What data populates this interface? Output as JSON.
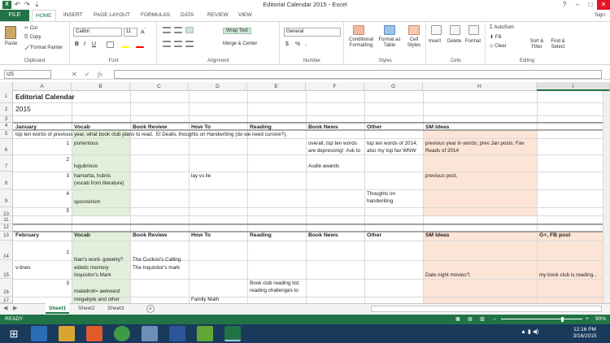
{
  "window": {
    "title": "Editorial Calendar 2015 - Excel",
    "signin": "Sign"
  },
  "quickaccess": {
    "undo": "↶",
    "redo": "↷",
    "more": "⇣"
  },
  "tabs": [
    "FILE",
    "HOME",
    "INSERT",
    "PAGE LAYOUT",
    "FORMULAS",
    "DATA",
    "REVIEW",
    "VIEW"
  ],
  "ribbon": {
    "clipboard": {
      "paste": "Paste",
      "cut": "Cut",
      "copy": "Copy",
      "painter": "Format Painter",
      "label": "Clipboard"
    },
    "font": {
      "name": "Calibri",
      "size": "11",
      "bold": "B",
      "italic": "I",
      "underline": "U",
      "label": "Font"
    },
    "alignment": {
      "wrap": "Wrap Text",
      "merge": "Merge & Center",
      "label": "Alignment"
    },
    "number": {
      "format": "General",
      "currency": "$",
      "percent": "%",
      "comma": ",",
      "label": "Number"
    },
    "styles": {
      "conditional": "Conditional Formatting",
      "table": "Format as Table",
      "cell": "Cell Styles",
      "label": "Styles"
    },
    "cells": {
      "insert": "Insert",
      "delete": "Delete",
      "format": "Format",
      "label": "Cells"
    },
    "editing": {
      "autosum": "AutoSum",
      "fill": "Fill",
      "clear": "Clear",
      "sort": "Sort & Filter",
      "find": "Find & Select",
      "label": "Editing"
    }
  },
  "formula_bar": {
    "name_box": "I25",
    "cancel": "✕",
    "enter": "✓",
    "fx": "fx",
    "value": ""
  },
  "columns": [
    "A",
    "B",
    "C",
    "D",
    "E",
    "F",
    "G",
    "H",
    "I"
  ],
  "rows": [
    "1",
    "2",
    "3",
    "4",
    "5",
    "6",
    "7",
    "8",
    "9",
    "10",
    "11",
    "12",
    "13",
    "14",
    "15",
    "16",
    "17"
  ],
  "cells": {
    "A1": "Editorial Calendar",
    "A2": "2015",
    "A4": "January",
    "B4": "Vocab",
    "C4": "Book Review",
    "D4": "How To",
    "E4": "Reading",
    "F4": "Book News",
    "G4": "Other",
    "H4": "SM Ideas",
    "A5": "top ten words of previous year, what book club plans to read,  El Deafo, thoughts on Handwriting (do we need cursive?),",
    "A6n": "1",
    "B6": "portentous",
    "F6": "overall, top ten words\nare depressing!  Ask to",
    "G6": "top ten words of 2014;\nalso my top fav WNW",
    "H6": "previous year in words; prev Jan posts; Fav\nReads of 2014",
    "A7n": "2",
    "B7": "lugubrious",
    "F7": "Audie awards",
    "A8n": "3",
    "B8": "hamartia, hubris\n(vocab from literature)",
    "D8": "lay vs lie",
    "H8": "previous post,",
    "A9n": "4",
    "B9": "spoonerism",
    "G9": "Thoughts on\nhandwriting",
    "A10n": "5",
    "A12": "February",
    "B12": "Vocab",
    "C12": "Book Review",
    "D12": "How To",
    "E12": "Reading",
    "F12": "Book News",
    "G12": "Other",
    "H12": "SM Ideas",
    "I12": "G+, FB post",
    "A13n": "1",
    "B14": "Nan's word- gowelry?",
    "C14": "The Cuckoo's Calling",
    "A15": "v-tines",
    "B15": "eidetic memory\nInquisitor's Mark",
    "C15": "The Inquisitor's mark",
    "H15": "Date night movies?;",
    "I15": "my book club is reading...",
    "A16n": "3",
    "B16": "maladroit= awkward",
    "E16": "Book club reading list;\nreading challenges to",
    "B17": "megabyte and other",
    "D17": "Family Math"
  },
  "sheets": [
    "Sheet1",
    "Sheet2",
    "Sheet3"
  ],
  "status": {
    "ready": "READY",
    "zoom": "90%"
  },
  "clock": {
    "time": "12:16 PM",
    "date": "3/16/2015"
  },
  "colors": {
    "excel_green": "#217346",
    "vocab_fill": "#e2efda",
    "sm_fill": "#fce4d6",
    "taskbar": "#1a3a5c"
  }
}
